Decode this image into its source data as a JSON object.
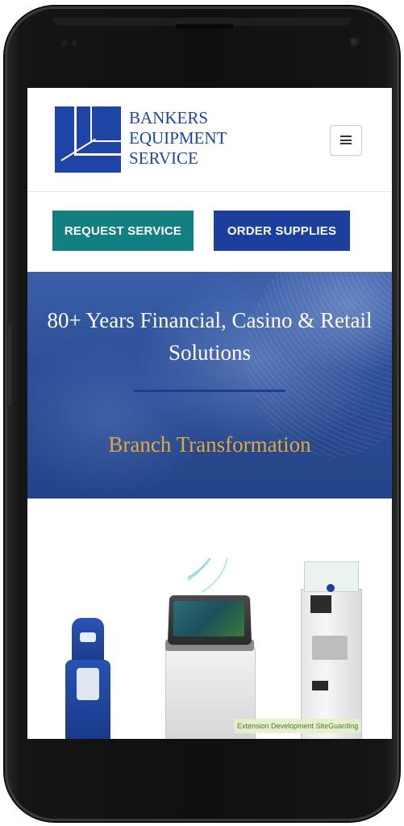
{
  "brand": {
    "name_lines": [
      "BANKERS",
      "EQUIPMENT",
      "SERVICE"
    ],
    "primary_color": "#1e44a6",
    "teal_color": "#127f83",
    "gold_color": "#e0a93a"
  },
  "header": {
    "menu_icon": "hamburger-icon"
  },
  "cta": {
    "request_service": "REQUEST SERVICE",
    "order_supplies": "ORDER SUPPLIES"
  },
  "hero": {
    "title": "80+ Years Financial, Casino & Retail Solutions",
    "subtitle": "Branch Transformation"
  },
  "products": {
    "watermark": "Extension Development SiteGuarding"
  }
}
